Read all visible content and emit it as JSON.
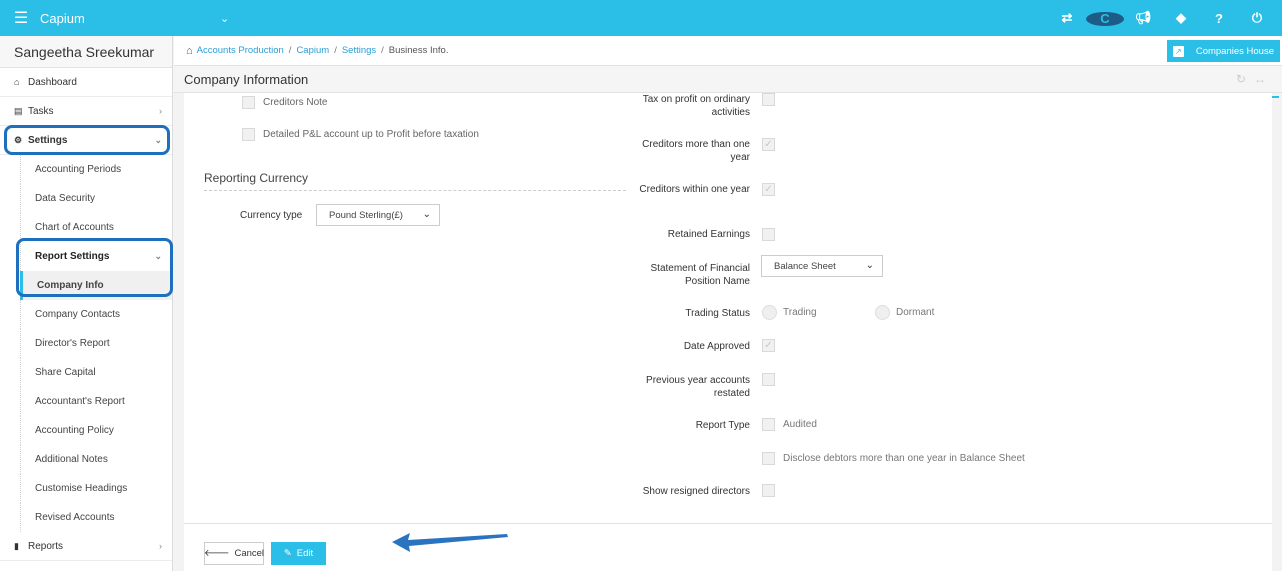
{
  "topbar": {
    "menu_icon": "hamburger-icon",
    "app_name": "Capium",
    "chevron": "⌄",
    "icons": [
      "transfer-icon",
      "capium-logo-icon",
      "megaphone-icon",
      "tag-icon",
      "help-icon",
      "power-icon"
    ],
    "help_glyph": "?"
  },
  "sidebar": {
    "user_name": "Sangeetha Sreekumar",
    "items": {
      "dashboard": "Dashboard",
      "tasks": "Tasks",
      "settings": "Settings",
      "reports": "Reports"
    },
    "settings_sub": {
      "accounting_periods": "Accounting Periods",
      "data_security": "Data Security",
      "chart_of_accounts": "Chart of Accounts",
      "report_settings": "Report Settings"
    },
    "report_sub": {
      "company_info": "Company Info",
      "company_contacts": "Company Contacts",
      "directors_report": "Director's Report",
      "share_capital": "Share Capital",
      "accountants_report": "Accountant's Report",
      "accounting_policy": "Accounting Policy",
      "additional_notes": "Additional Notes",
      "customise_headings": "Customise Headings",
      "revised_accounts": "Revised Accounts"
    }
  },
  "breadcrumb": {
    "items": [
      "Accounts Production",
      "Capium",
      "Settings"
    ],
    "current": "Business Info.",
    "separator": "/",
    "companies_house": "Companies House"
  },
  "panel": {
    "title": "Company Information"
  },
  "left_form": {
    "creditors_note": "Creditors Note",
    "detailed_pl": "Detailed P&L account up to Profit before taxation",
    "reporting_currency_title": "Reporting Currency",
    "currency_type_label": "Currency type",
    "currency_type_value": "Pound Sterling(£)"
  },
  "right_form": {
    "tax_on_profit": "Tax on profit on ordinary activities",
    "creditors_more": "Creditors more than one year",
    "creditors_within": "Creditors within one year",
    "retained_earnings": "Retained Earnings",
    "statement_label": "Statement of Financial Position Name",
    "statement_value": "Balance Sheet",
    "trading_status_label": "Trading Status",
    "trading_option": "Trading",
    "dormant_option": "Dormant",
    "date_approved": "Date Approved",
    "previous_year": "Previous year accounts restated",
    "report_type_label": "Report Type",
    "audited_option": "Audited",
    "disclose_debtors": "Disclose debtors more than one year in Balance Sheet",
    "show_resigned": "Show resigned directors"
  },
  "footer": {
    "cancel_label": "Cancel",
    "edit_label": "Edit"
  }
}
